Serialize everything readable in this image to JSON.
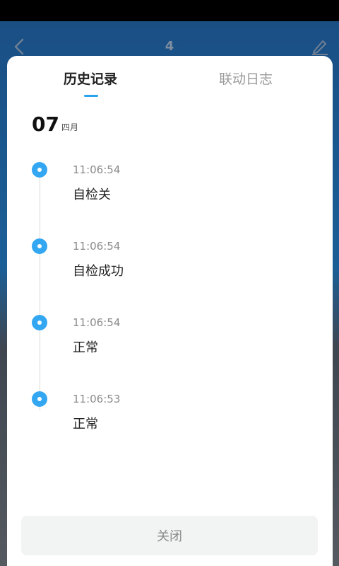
{
  "header": {
    "title": "4"
  },
  "tabs": {
    "history": "历史记录",
    "linkage": "联动日志"
  },
  "date": {
    "day": "07",
    "month": "四月"
  },
  "entries": [
    {
      "time": "11:06:54",
      "text": "自检关"
    },
    {
      "time": "11:06:54",
      "text": "自检成功"
    },
    {
      "time": "11:06:54",
      "text": "正常"
    },
    {
      "time": "11:06:53",
      "text": "正常"
    }
  ],
  "close_label": "关闭",
  "colors": {
    "accent": "#34a7f2",
    "header_bg": "#1a4f84"
  }
}
